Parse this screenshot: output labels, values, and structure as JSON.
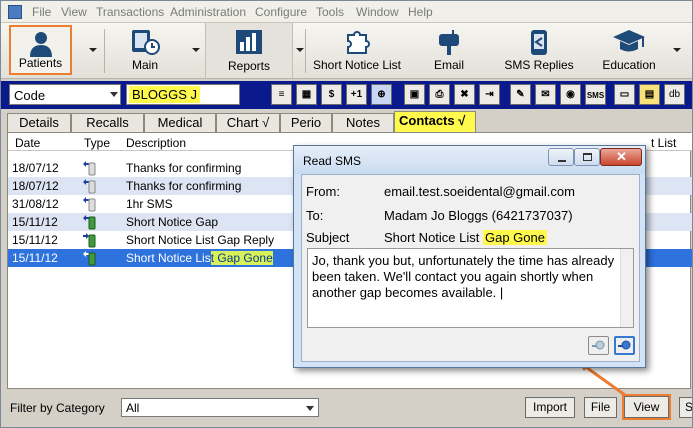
{
  "menubar": {
    "items": [
      "File",
      "View",
      "Transactions",
      "Administration",
      "Configure",
      "Tools",
      "Window",
      "Help"
    ]
  },
  "toolbar": {
    "buttons": [
      "Patients",
      "Main",
      "Reports",
      "Short Notice List",
      "Email",
      "SMS Replies",
      "Education"
    ]
  },
  "selector": {
    "code_value": "Code",
    "patient_name": "BLOGGS J",
    "button_labels": {
      "dollar": "$",
      "plus_one": "+1",
      "sms": "SMS",
      "db": "db"
    }
  },
  "tabs": [
    "Details",
    "Recalls",
    "Medical",
    "Chart √",
    "Perio",
    "Notes",
    "Contacts √"
  ],
  "list": {
    "headers": {
      "date": "Date",
      "type": "Type",
      "description": "Description",
      "trailing": "t List"
    },
    "rows": [
      {
        "date": "18/07/12",
        "description": "Thanks for confirming"
      },
      {
        "date": "18/07/12",
        "description": "Thanks for confirming"
      },
      {
        "date": "31/08/12",
        "description": "1hr SMS"
      },
      {
        "date": "15/11/12",
        "description": "Short Notice Gap"
      },
      {
        "date": "15/11/12",
        "description": "Short Notice List Gap Reply"
      },
      {
        "date": "15/11/12",
        "description_prefix": "Short Notice Lis",
        "description_highlight": "t Gap Gone"
      }
    ]
  },
  "filter": {
    "label": "Filter by Category",
    "value": "All"
  },
  "bottom_buttons": {
    "import": "Import",
    "file": "File",
    "view": "View",
    "extra": "S"
  },
  "dialog": {
    "title": "Read SMS",
    "from_label": "From:",
    "from_value": "email.test.soeidental@gmail.com",
    "to_label": "To:",
    "to_value": "Madam Jo Bloggs (6421737037)",
    "subject_label": "Subject",
    "subject_prefix": "Short Notice List ",
    "subject_highlight": "Gap Gone",
    "message": "Jo, thank you but, unfortunately the time has already been taken. We'll contact you again shortly when another gap becomes available. |"
  },
  "colors": {
    "highlight_yellow": "#fff94c",
    "callout_orange": "#ed7d31",
    "selection_blue": "#2e72dd",
    "patient_bar_navy": "#0a1a8c"
  }
}
